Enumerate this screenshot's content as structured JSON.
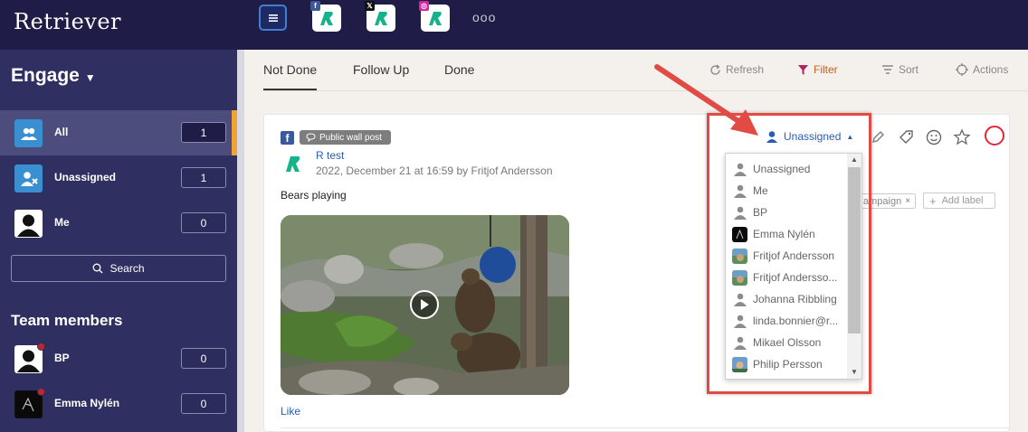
{
  "header": {
    "logo": "Retriever",
    "channels": [
      {
        "badge": "f",
        "badge_color": "#3b5998"
      },
      {
        "badge": "𝕏",
        "badge_color": "#111111"
      },
      {
        "badge": "◎",
        "badge_color": "#d6249f"
      }
    ],
    "more": "ooo"
  },
  "sidebar": {
    "title": "Engage",
    "items": [
      {
        "label": "All",
        "count": "1"
      },
      {
        "label": "Unassigned",
        "count": "1"
      },
      {
        "label": "Me",
        "count": "0"
      }
    ],
    "search_label": "Search",
    "team_title": "Team members",
    "team": [
      {
        "label": "BP",
        "count": "0"
      },
      {
        "label": "Emma Nylén",
        "count": "0"
      }
    ]
  },
  "tabs": [
    "Not Done",
    "Follow Up",
    "Done"
  ],
  "toolbar": {
    "refresh": "Refresh",
    "filter": "Filter",
    "sort": "Sort",
    "actions": "Actions"
  },
  "post": {
    "type_label": "Public wall post",
    "author": "R test",
    "meta": "2022, December 21 at 16:59 by Fritjof Andersson",
    "text": "Bears playing",
    "like": "Like",
    "assignee": "Unassigned",
    "label_chip": "ampaign",
    "add_label": "Add label"
  },
  "dropdown": {
    "items": [
      "Unassigned",
      "Me",
      "BP",
      "Emma Nylén",
      "Fritjof Andersson",
      "Fritjof Andersso...",
      "Johanna Ribbling",
      "linda.bonnier@r...",
      "Mikael Olsson",
      "Philip Persson"
    ]
  },
  "colors": {
    "accent": "#f0a233",
    "highlight": "#e14b43",
    "link": "#2a5db0",
    "nav_bg": "#1f1d47",
    "sidebar_bg": "#2f2f62"
  }
}
